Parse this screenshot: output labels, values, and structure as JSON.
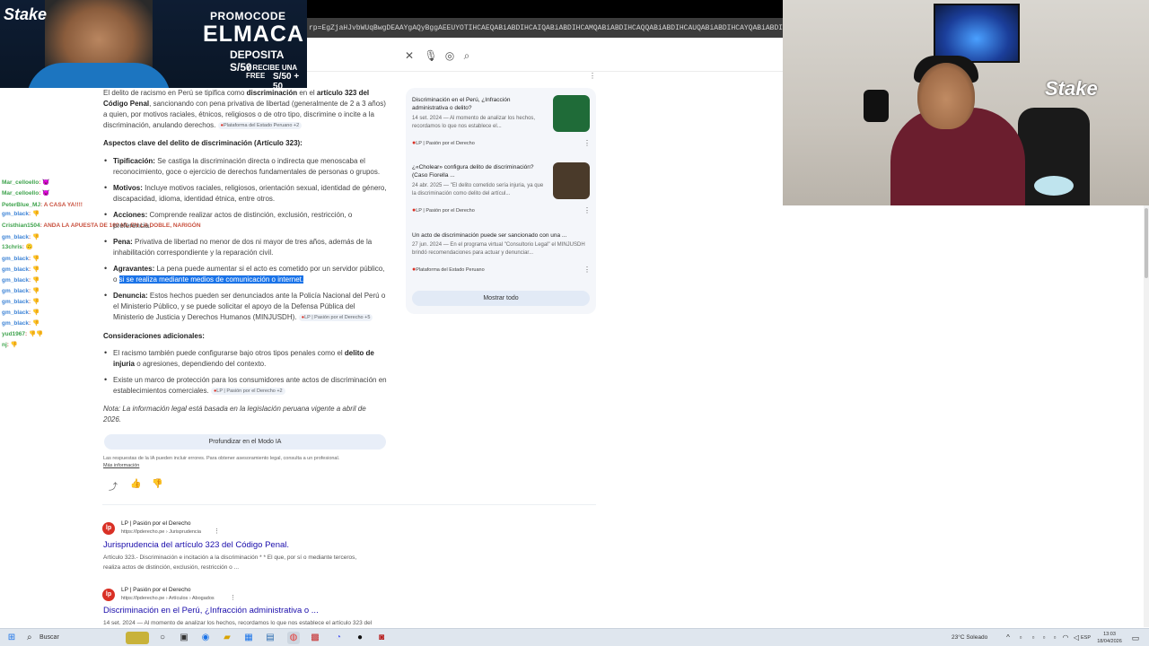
{
  "browser": {
    "address_text": "rp=EgZjaHJvbWUqBwgDEAAYgAQyBggAEEUYOTIHCAEQABiABDIHCAIQABiABDIHCAMQABiABDIHCAQQABiABDIHCAUQABiABDIHCAYQABiABDIHCAcQABiABDIHCAgQABiABA",
    "search_clear_icon": "close-icon",
    "search_voice_icon": "mic-icon",
    "search_lens_icon": "lens-icon",
    "search_go_icon": "search-icon"
  },
  "promo": {
    "brand": "Stake",
    "line1": "PROMOCODE",
    "line2": "ELMACA",
    "line3": "DEPOSITA S/50",
    "line4": "Y RECIBE UNA FREE",
    "line5": "S/50 + 50"
  },
  "chat": [
    {
      "user": "Mar_celloello",
      "msg": ": 👿",
      "blue": false
    },
    {
      "user": "Mar_celloello",
      "msg": ": 👿",
      "blue": false
    },
    {
      "user": "PeterBlue_MJ",
      "msg": ": A CASA YA!!!!",
      "blue": false
    },
    {
      "user": "gm_black",
      "msg": ": 👎",
      "blue": true
    },
    {
      "user": "Cristhian1504",
      "msg": ": ANDA LA APUESTA DE 100 ML EN LA DOBLE, NARIGÓN",
      "blue": false
    },
    {
      "user": "gm_black",
      "msg": ": 👎",
      "blue": true
    },
    {
      "user": "13chris",
      "msg": ": 🙃",
      "blue": false
    },
    {
      "user": "gm_black",
      "msg": ": 👎",
      "blue": true
    },
    {
      "user": "gm_black",
      "msg": ": 👎",
      "blue": true
    },
    {
      "user": "gm_black",
      "msg": ": 👎",
      "blue": true
    },
    {
      "user": "gm_black",
      "msg": ": 👎",
      "blue": true
    },
    {
      "user": "gm_black",
      "msg": ": 👎",
      "blue": true
    },
    {
      "user": "gm_black",
      "msg": ": 👎",
      "blue": true
    },
    {
      "user": "gm_black",
      "msg": ": 👎",
      "blue": true
    },
    {
      "user": "yud1967",
      "msg": ": 👎👎",
      "blue": false
    },
    {
      "user": "nj",
      "msg": ": 👎",
      "blue": false
    }
  ],
  "ai": {
    "intro_a": "El delito de racismo en Perú se tipifica como ",
    "intro_b": "discriminación",
    "intro_c": " en el ",
    "intro_d": "artículo 323 del",
    "intro_e": "Código Penal",
    "intro_f": ", sancionando con pena privativa de libertad (generalmente de 2 a 3 años)",
    "intro_g": "a quien, por motivos raciales, étnicos, religiosos o de otro tipo, discrimine o incite a la",
    "intro_h": "discriminación, anulando derechos.",
    "intro_src": "Plataforma del Estado Peruano +2",
    "heading1": "Aspectos clave del delito de discriminación (Artículo 323):",
    "b1_label": "Tipificación:",
    "b1_a": " Se castiga la discriminación directa o indirecta que menoscaba el",
    "b1_b": "reconocimiento, goce o ejercicio de derechos fundamentales de personas o grupos.",
    "b2_label": "Motivos:",
    "b2_a": " Incluye motivos raciales, religiosos, orientación sexual, identidad de género,",
    "b2_b": "discapacidad, idioma, identidad étnica, entre otros.",
    "b3_label": "Acciones:",
    "b3_a": " Comprende realizar actos de distinción, exclusión, restricción, o",
    "b3_b": "preferencia.",
    "b4_label": "Pena:",
    "b4_a": " Privativa de libertad no menor de dos ni mayor de tres años, además de la",
    "b4_b": "inhabilitación correspondiente y la reparación civil.",
    "b5_label": "Agravantes:",
    "b5_a": " La pena puede aumentar si el acto es cometido por un servidor público,",
    "b5_b1": "o ",
    "b5_b2": "si se realiza mediante medios de comunicación o internet.",
    "b6_label": "Denuncia:",
    "b6_a": " Estos hechos pueden ser denunciados ante la Policía Nacional del Perú o",
    "b6_b": "el Ministerio Público, y se puede solicitar el apoyo de la Defensa Pública del",
    "b6_c": "Ministerio de Justicia y Derechos Humanos (MINJUSDH).",
    "b6_src": "LP | Pasión por el Derecho +5",
    "heading2": "Consideraciones adicionales:",
    "c1_a": "El racismo también puede configurarse bajo otros tipos penales como el ",
    "c1_b": "delito de",
    "c1_c": "injuria",
    "c1_d": " o agresiones, dependiendo del contexto.",
    "c2_a": "Existe un marco de protección para los consumidores ante actos de discriminación en",
    "c2_b": "establecimientos comerciales.",
    "c2_src": "LP | Pasión por el Derecho +2",
    "note_a": "Nota",
    "note_b": ": La información legal está basada en la legislación peruana vigente a abril de",
    "note_c": "2026.",
    "deep_button": "Profundizar en el Modo IA",
    "disclaimer": "Las respuestas de la IA pueden incluir errores. Para obtener asesoramiento legal, consulta a un profesional.",
    "more_info": "Más información"
  },
  "cards": [
    {
      "title": "Discriminación en el Perú, ¿Infracción administrativa o delito?",
      "snippet": "14 set. 2024 — Al momento de analizar los hechos, recordamos lo que nos establece el...",
      "source": "LP | Pasión por el Derecho",
      "thumb_color": "#1f6b38"
    },
    {
      "title": "¿«Cholear» configura delito de discriminación? (Caso Fiorella ...",
      "snippet": "24 abr. 2025 — \"El delito cometido sería injuria, ya que la discriminación como delito del artícul...",
      "source": "LP | Pasión por el Derecho",
      "thumb_color": "#4a3a2a"
    },
    {
      "title": "Un acto de discriminación puede ser sancionado con una ...",
      "snippet": "27 jun. 2024 — En el programa virtual \"Consultorio Legal\" el MINJUSDH brindó recomendaciones para actuar y denunciar...",
      "source": "Plataforma del Estado Peruano"
    }
  ],
  "show_all": "Mostrar todo",
  "results": [
    {
      "site": "LP | Pasión por el Derecho",
      "url": "https://lpderecho.pe › Jurisprudencia",
      "title": "Jurisprudencia del artículo 323 del Código Penal.",
      "snippet_a": "Artículo 323.- Discriminación e incitación a la discriminación * * El que, por sí o mediante terceros,",
      "snippet_b": "realiza actos de distinción, exclusión, restricción o ..."
    },
    {
      "site": "LP | Pasión por el Derecho",
      "url": "https://lpderecho.pe › Artículos › Abogados",
      "title": "Discriminación en el Perú, ¿Infracción administrativa o ...",
      "snippet_a": "14 set. 2024 — Al momento de analizar los hechos, recordamos lo que nos establece el artículo 323 del",
      "snippet_b": ""
    }
  ],
  "webcam": {
    "brand": "Stake"
  },
  "taskbar": {
    "search_label": "Buscar",
    "weather": "23°C  Soleado",
    "lang": "ESP",
    "time": "13:03",
    "date": "18/04/2026"
  }
}
